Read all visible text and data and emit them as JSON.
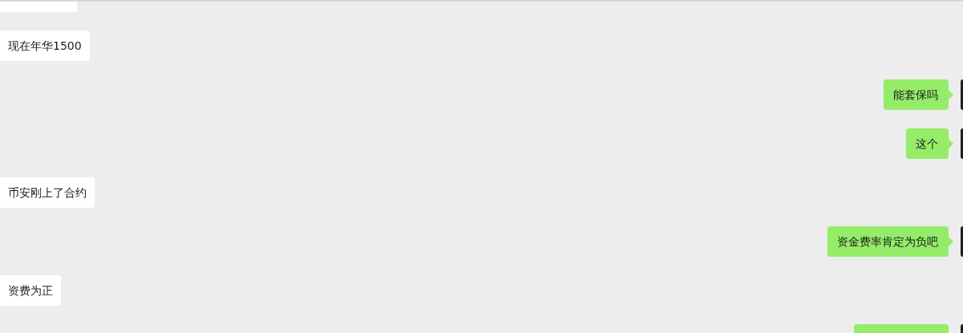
{
  "messages": [
    {
      "outgoing": false,
      "kind": "partial"
    },
    {
      "outgoing": false,
      "kind": "text",
      "text": "现在年华1500"
    },
    {
      "outgoing": true,
      "kind": "text",
      "text": "能套保吗"
    },
    {
      "outgoing": true,
      "kind": "text",
      "text": "这个"
    },
    {
      "outgoing": false,
      "kind": "text",
      "text": "币安刚上了合约"
    },
    {
      "outgoing": true,
      "kind": "text",
      "text": "资金费率肯定为负吧"
    },
    {
      "outgoing": false,
      "kind": "text",
      "text": "资费为正"
    },
    {
      "outgoing": true,
      "kind": "partial"
    }
  ]
}
